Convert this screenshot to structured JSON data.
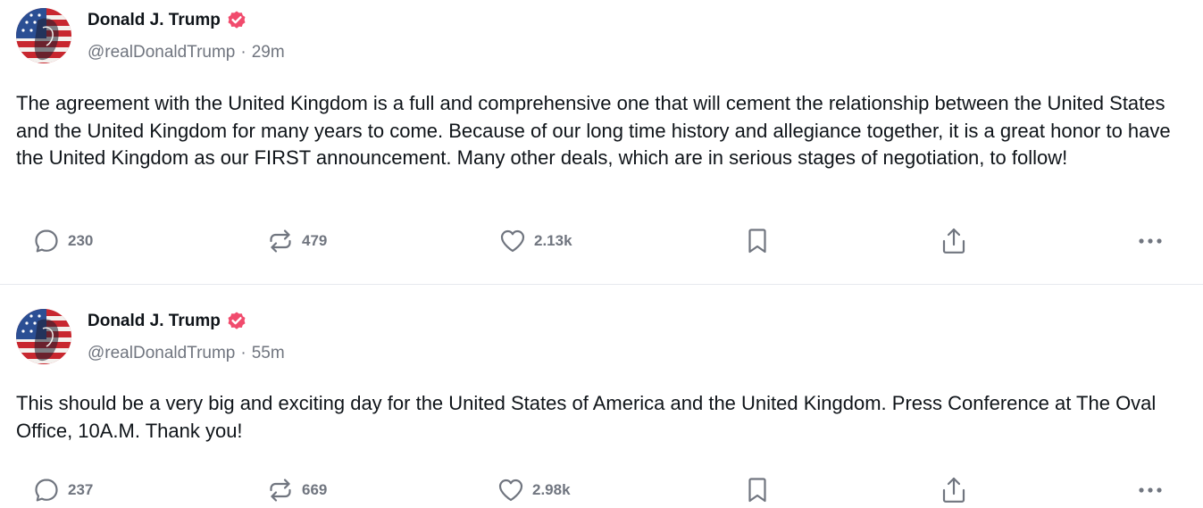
{
  "posts": [
    {
      "author": {
        "display_name": "Donald J. Trump",
        "handle": "@realDonaldTrump",
        "verified_icon": "verified-badge-icon"
      },
      "separator": "·",
      "time": "29m",
      "text": "The agreement with the United Kingdom is a full and comprehensive one that will cement the relationship between the United States and the United Kingdom for many years to come. Because of our long time history and allegiance together, it is a great honor to have the United Kingdom as our FIRST announcement. Many other deals, which are in serious stages of negotiation, to follow!",
      "actions": {
        "replies": "230",
        "reposts": "479",
        "likes": "2.13k"
      }
    },
    {
      "author": {
        "display_name": "Donald J. Trump",
        "handle": "@realDonaldTrump",
        "verified_icon": "verified-badge-icon"
      },
      "separator": "·",
      "time": "55m",
      "text": "This should be a very big and exciting day for the United States of America and the United Kingdom. Press Conference at The Oval Office, 10A.M. Thank you!",
      "actions": {
        "replies": "237",
        "reposts": "669",
        "likes": "2.98k"
      }
    }
  ],
  "icons": {
    "reply": "comment-bubble-icon",
    "repost": "repost-arrows-icon",
    "like": "heart-icon",
    "bookmark": "bookmark-icon",
    "share": "share-upload-icon",
    "more": "more-dots-icon"
  },
  "colors": {
    "text": "#0f1419",
    "muted": "#70757f",
    "verified": "#f14b6d",
    "divider": "#e7e9ee"
  }
}
